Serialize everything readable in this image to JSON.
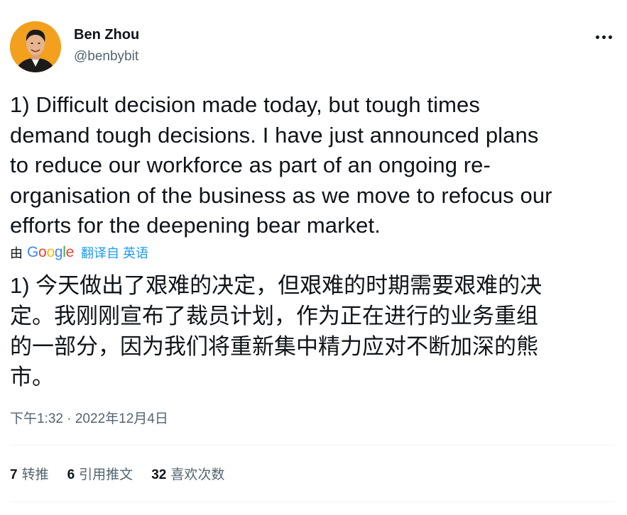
{
  "author": {
    "name": "Ben Zhou",
    "handle": "@benbybit"
  },
  "tweet": {
    "lines": [
      "1) Difficult decision made today, but tough times",
      "demand tough decisions. I have just announced plans",
      "to reduce our workforce as part of an ongoing re-",
      "organisation of the business as we move to refocus our",
      "efforts for the deepening bear market."
    ]
  },
  "translation": {
    "prefix": "由",
    "provider": "Google",
    "link_text": "翻译自 英语",
    "lines": [
      "1) 今天做出了艰难的决定，但艰难的时期需要艰难的决",
      "定。我刚刚宣布了裁员计划，作为正在进行的业务重组",
      "的一部分，因为我们将重新集中精力应对不断加深的熊",
      "市。"
    ]
  },
  "timestamp": "下午1:32 · 2022年12月4日",
  "stats": {
    "retweets": {
      "count": "7",
      "label": "转推"
    },
    "quotes": {
      "count": "6",
      "label": "引用推文"
    },
    "likes": {
      "count": "32",
      "label": "喜欢次数"
    }
  },
  "colors": {
    "text": "#0f1419",
    "secondary": "#536471",
    "link": "#1d9bf0",
    "divider": "#eff3f4"
  },
  "icons": {
    "more": "more-horizontal-icon",
    "avatar": "profile-avatar"
  }
}
